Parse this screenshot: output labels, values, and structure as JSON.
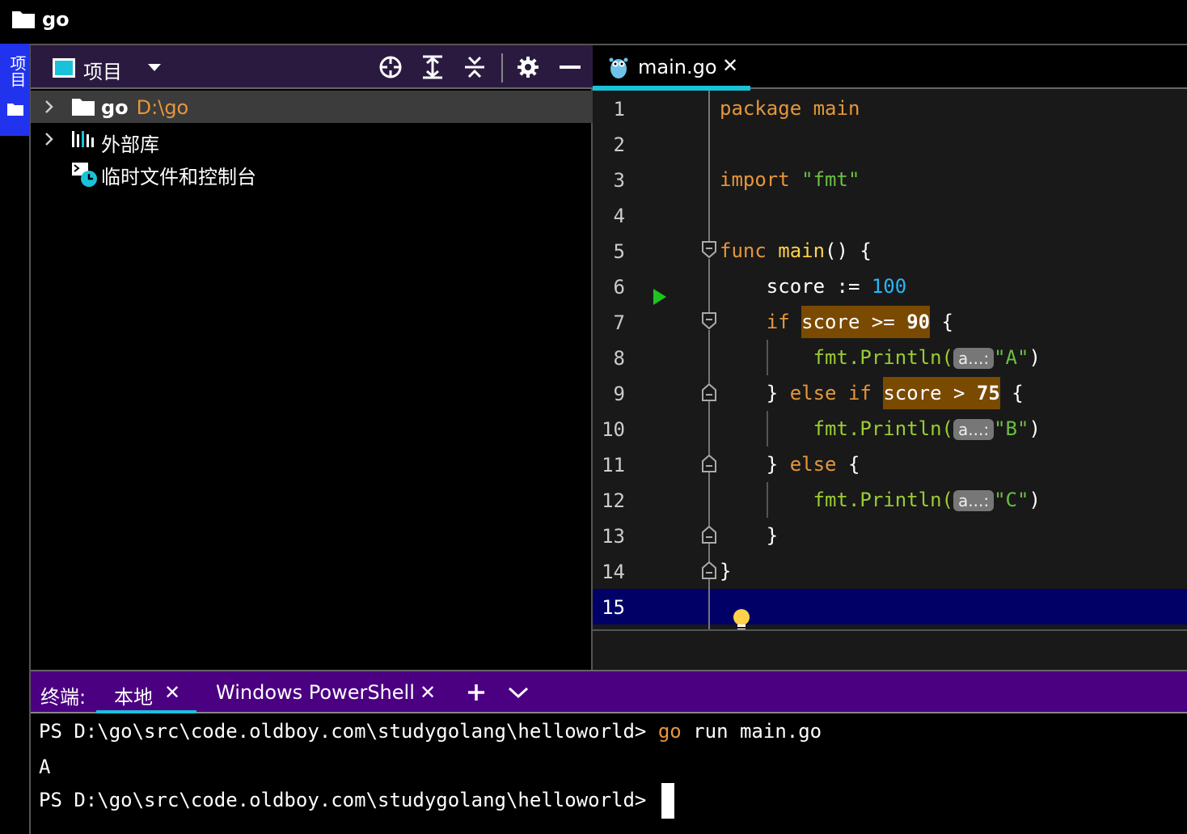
{
  "window": {
    "title": "go"
  },
  "sidebar_strip": {
    "tab_label": "项目"
  },
  "project_panel": {
    "view_label": "项目",
    "tree": [
      {
        "name": "go",
        "path": "D:\\go",
        "icon": "folder-icon",
        "expandable": true,
        "selected": true
      },
      {
        "name": "外部库",
        "icon": "library-icon",
        "expandable": true
      },
      {
        "name": "临时文件和控制台",
        "icon": "scratch-icon",
        "expandable": false
      }
    ]
  },
  "editor": {
    "tab": {
      "label": "main.go",
      "icon": "gopher-icon"
    },
    "line_numbers": [
      "1",
      "2",
      "3",
      "4",
      "5",
      "6",
      "7",
      "8",
      "9",
      "10",
      "11",
      "12",
      "13",
      "14",
      "15"
    ],
    "current_line": 15,
    "code": {
      "l1": {
        "kw": "package",
        "name": "main"
      },
      "l3": {
        "kw": "import",
        "str": "\"fmt\""
      },
      "l5": {
        "kw": "func",
        "fn": "main",
        "rest": "() {"
      },
      "l6": {
        "var": "score",
        "op": " := ",
        "num": "100"
      },
      "l7": {
        "kw": "if",
        "cond_a": "score >= ",
        "cond_b": "90",
        "rest": " {"
      },
      "l8": {
        "pkg": "fmt",
        "call": ".Println(",
        "hint": "a...:",
        "str": "\"A\"",
        "close": ")"
      },
      "l9": {
        "open": "} ",
        "kw": "else if",
        "cond_a": "score > ",
        "cond_b": "75",
        "rest": " {"
      },
      "l10": {
        "pkg": "fmt",
        "call": ".Println(",
        "hint": "a...:",
        "str": "\"B\"",
        "close": ")"
      },
      "l11": {
        "open": "} ",
        "kw": "else",
        "rest": " {"
      },
      "l12": {
        "pkg": "fmt",
        "call": ".Println(",
        "hint": "a...:",
        "str": "\"C\"",
        "close": ")"
      },
      "l13": {
        "text": "}"
      },
      "l14": {
        "text": "}"
      }
    }
  },
  "terminal": {
    "label": "终端:",
    "tabs": [
      {
        "label": "本地",
        "active": true
      },
      {
        "label": "Windows PowerShell",
        "active": false
      }
    ],
    "lines": [
      {
        "prompt": "PS D:\\go\\src\\code.oldboy.com\\studygolang\\helloworld> ",
        "cmd": "go",
        "args": " run main.go"
      },
      {
        "text": "A"
      },
      {
        "prompt": "PS D:\\go\\src\\code.oldboy.com\\studygolang\\helloworld> "
      }
    ]
  },
  "colors": {
    "accent": "#19c2d9",
    "strip_tab": "#2233ee",
    "terminal_bar": "#4b0082",
    "keyword": "#e6963a",
    "string": "#6ac043",
    "number": "#29b6f6",
    "highlight": "#7a4a00",
    "current_line": "#000066"
  }
}
